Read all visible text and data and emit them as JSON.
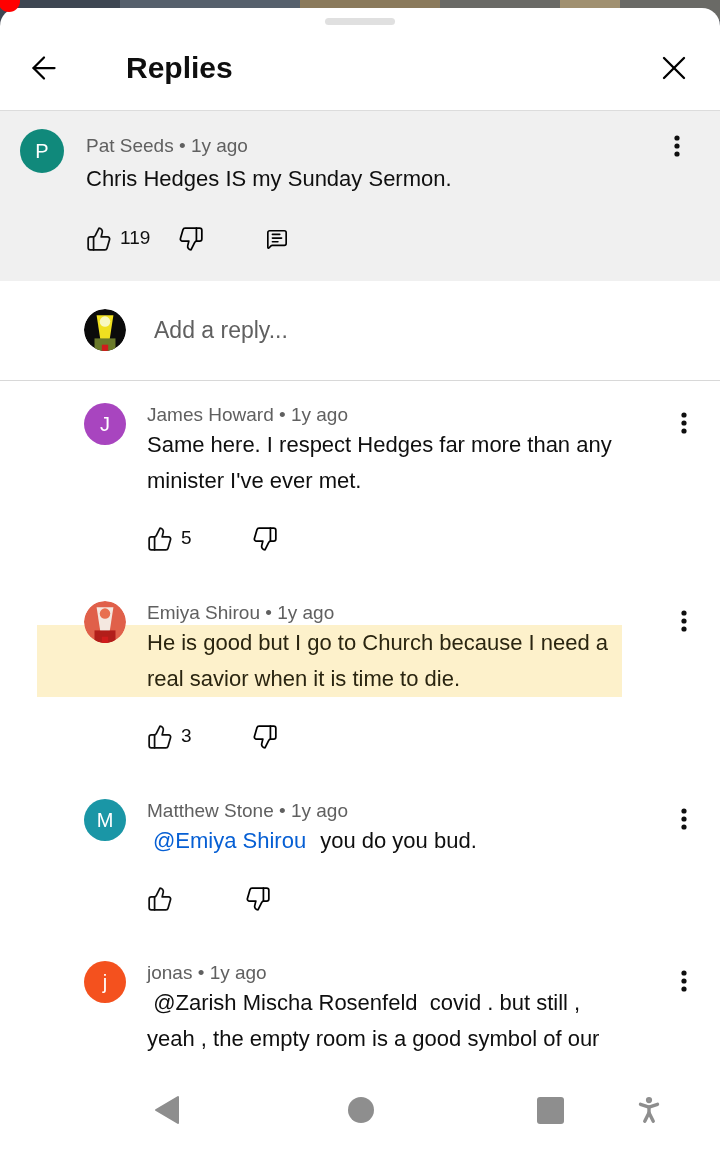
{
  "header": {
    "title": "Replies"
  },
  "pinned": {
    "byline": "Pat Seeds • 1y ago",
    "text": "Chris Hedges IS my Sunday Sermon.",
    "likes": "119",
    "avatar": {
      "kind": "letter",
      "letter": "P",
      "color": "#10897b"
    }
  },
  "composer": {
    "placeholder": "Add a reply..."
  },
  "replies": [
    {
      "byline": "James Howard • 1y ago",
      "text": "Same here. I respect Hedges far more than any minister I've ever met.",
      "likes": "5",
      "highlighted": false,
      "avatar": {
        "kind": "letter",
        "letter": "J",
        "color": "#a845bf"
      }
    },
    {
      "byline": "Emiya Shirou • 1y ago",
      "text": "He is good but I go to Church because I need a real savior when it is time to die.",
      "likes": "3",
      "highlighted": true
    },
    {
      "byline": "Matthew Stone • 1y ago",
      "mention": "@Emiya Shirou",
      "text": "you do you bud.",
      "highlighted": false,
      "avatar": {
        "kind": "letter",
        "letter": "M",
        "color": "#1a96a6"
      }
    },
    {
      "byline": "jonas • 1y ago",
      "text": " @Zarish Mischa Rosenfeld  covid . but still , yeah , the empty room is a good symbol of our",
      "highlighted": false,
      "avatar": {
        "kind": "letter",
        "letter": "j",
        "color": "#f4511e"
      }
    }
  ]
}
